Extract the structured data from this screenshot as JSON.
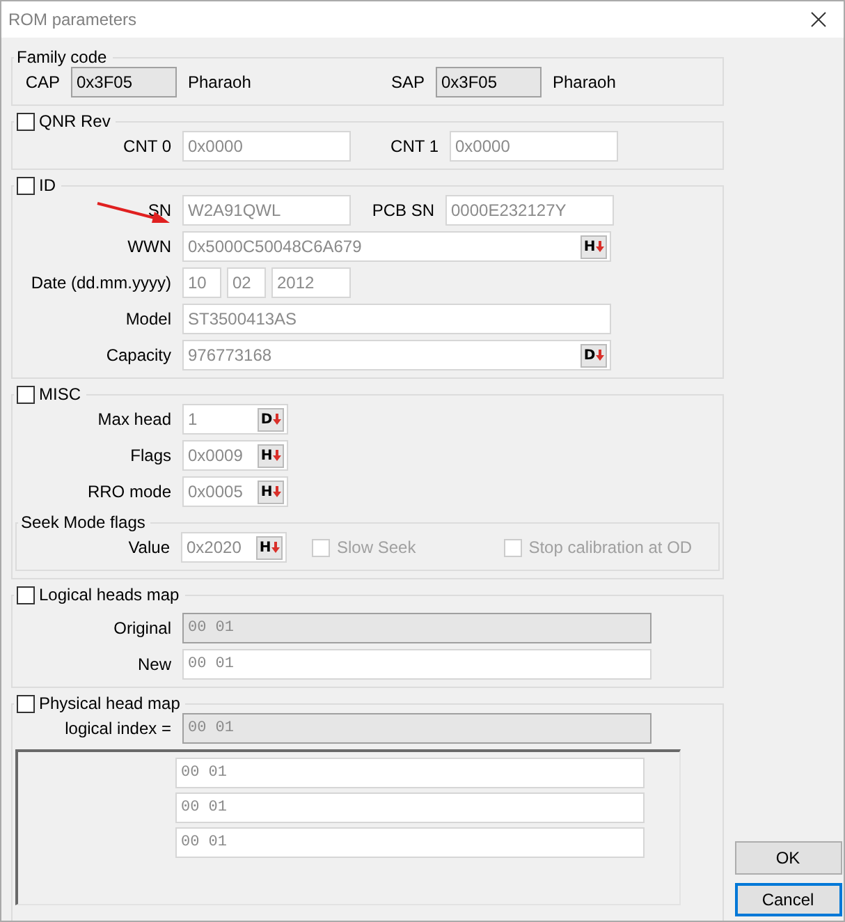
{
  "window": {
    "title": "ROM parameters"
  },
  "family_code": {
    "title": "Family code",
    "fields": [
      {
        "label": "CAP",
        "value": "0x3F05",
        "name": "Pharaoh"
      },
      {
        "label": "SAP",
        "value": "0x3F05",
        "name": "Pharaoh"
      }
    ]
  },
  "qnr_rev": {
    "label": "QNR Rev",
    "checked": false,
    "fields": [
      {
        "label": "CNT 0",
        "value": "0x0000"
      },
      {
        "label": "CNT 1",
        "value": "0x0000"
      }
    ]
  },
  "id": {
    "label": "ID",
    "checked": false,
    "sn": {
      "label": "SN",
      "value": "W2A91QWL"
    },
    "pcb_sn": {
      "label": "PCB SN",
      "value": "0000E232127Y"
    },
    "wwn": {
      "label": "WWN",
      "value": "0x5000C50048C6A679",
      "button": "H"
    },
    "date": {
      "label": "Date (dd.mm.yyyy)",
      "parts": [
        "10",
        "02",
        "2012"
      ]
    },
    "model": {
      "label": "Model",
      "value": "ST3500413AS"
    },
    "capacity": {
      "label": "Capacity",
      "value": "976773168",
      "button": "D"
    }
  },
  "misc": {
    "label": "MISC",
    "checked": false,
    "rows": [
      {
        "label": "Max head",
        "value": "1",
        "button": "D"
      },
      {
        "label": "Flags",
        "value": "0x0009",
        "button": "H"
      },
      {
        "label": "RRO mode",
        "value": "0x0005",
        "button": "H"
      }
    ],
    "seek_mode": {
      "title": "Seek Mode flags",
      "value": {
        "label": "Value",
        "value": "0x2020",
        "button": "H"
      },
      "options": [
        {
          "label": "Slow Seek",
          "checked": false
        },
        {
          "label": "Stop calibration at OD",
          "checked": false
        }
      ]
    }
  },
  "logical_heads_map": {
    "label": "Logical heads map",
    "checked": false,
    "rows": [
      {
        "label": "Original",
        "value": "00 01",
        "readonly": true
      },
      {
        "label": "New",
        "value": "00 01",
        "readonly": false
      }
    ]
  },
  "physical_head_map": {
    "label": "Physical head map",
    "checked": false,
    "logical_index": {
      "label": "logical index =",
      "value": "00 01"
    },
    "rows": [
      "00 01",
      "00 01",
      "00 01"
    ]
  },
  "buttons": [
    {
      "label": "OK",
      "default": false
    },
    {
      "label": "Cancel",
      "default": true
    }
  ]
}
